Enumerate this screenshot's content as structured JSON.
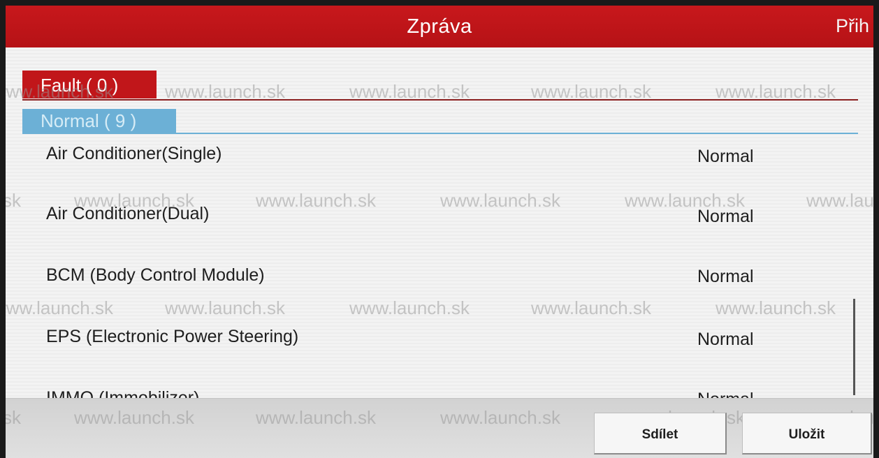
{
  "header": {
    "title": "Zpráva",
    "login_label": "Přih"
  },
  "tabs": {
    "fault": {
      "label": "Fault ( 0 )"
    },
    "normal": {
      "label": "Normal  ( 9 )"
    }
  },
  "systems": [
    {
      "name": "Air Conditioner(Single)",
      "status": "Normal"
    },
    {
      "name": "Air Conditioner(Dual)",
      "status": "Normal"
    },
    {
      "name": "BCM (Body Control Module)",
      "status": "Normal"
    },
    {
      "name": "EPS (Electronic Power Steering)",
      "status": "Normal"
    },
    {
      "name": "IMMO (Immobilizer)",
      "status": "Normal"
    }
  ],
  "watermark": {
    "text": "www.launch.sk"
  },
  "footer": {
    "share_label": "Sdílet",
    "save_label": "Uložit"
  },
  "colors": {
    "header_red": "#c8181c",
    "normal_tab_blue": "#6cb0d6"
  }
}
